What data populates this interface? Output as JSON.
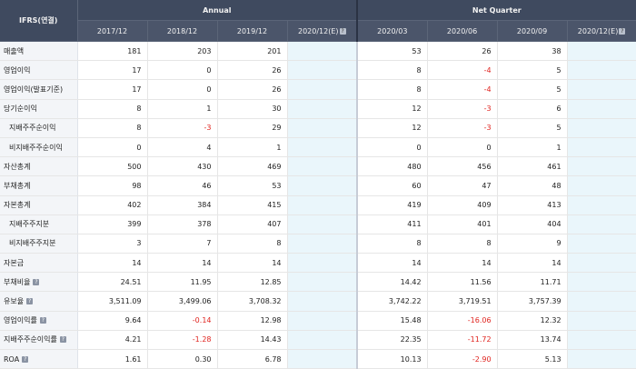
{
  "header": {
    "corner_label": "IFRS(연결)",
    "group_annual": "Annual",
    "group_quarter": "Net Quarter",
    "annual_cols": [
      "2017/12",
      "2018/12",
      "2019/12",
      "2020/12(E)"
    ],
    "quarter_cols": [
      "2020/03",
      "2020/06",
      "2020/09",
      "2020/12(E)"
    ],
    "estimate_help_icon": "?"
  },
  "rows": [
    {
      "label": "매출액",
      "indent": false,
      "help": false,
      "values": [
        "181",
        "203",
        "201",
        "",
        "53",
        "26",
        "38",
        ""
      ],
      "neg": [
        false,
        false,
        false,
        false,
        false,
        false,
        false,
        false
      ]
    },
    {
      "label": "영업이익",
      "indent": false,
      "help": false,
      "values": [
        "17",
        "0",
        "26",
        "",
        "8",
        "-4",
        "5",
        ""
      ],
      "neg": [
        false,
        false,
        false,
        false,
        false,
        true,
        false,
        false
      ]
    },
    {
      "label": "영업이익(발표기준)",
      "indent": false,
      "help": false,
      "values": [
        "17",
        "0",
        "26",
        "",
        "8",
        "-4",
        "5",
        ""
      ],
      "neg": [
        false,
        false,
        false,
        false,
        false,
        true,
        false,
        false
      ]
    },
    {
      "label": "당기순이익",
      "indent": false,
      "help": false,
      "values": [
        "8",
        "1",
        "30",
        "",
        "12",
        "-3",
        "6",
        ""
      ],
      "neg": [
        false,
        false,
        false,
        false,
        false,
        true,
        false,
        false
      ]
    },
    {
      "label": "지배주주순이익",
      "indent": true,
      "help": false,
      "values": [
        "8",
        "-3",
        "29",
        "",
        "12",
        "-3",
        "5",
        ""
      ],
      "neg": [
        false,
        true,
        false,
        false,
        false,
        true,
        false,
        false
      ]
    },
    {
      "label": "비지배주주순이익",
      "indent": true,
      "help": false,
      "values": [
        "0",
        "4",
        "1",
        "",
        "0",
        "0",
        "1",
        ""
      ],
      "neg": [
        false,
        false,
        false,
        false,
        false,
        false,
        false,
        false
      ]
    },
    {
      "label": "자산총계",
      "indent": false,
      "help": false,
      "values": [
        "500",
        "430",
        "469",
        "",
        "480",
        "456",
        "461",
        ""
      ],
      "neg": [
        false,
        false,
        false,
        false,
        false,
        false,
        false,
        false
      ]
    },
    {
      "label": "부채총계",
      "indent": false,
      "help": false,
      "values": [
        "98",
        "46",
        "53",
        "",
        "60",
        "47",
        "48",
        ""
      ],
      "neg": [
        false,
        false,
        false,
        false,
        false,
        false,
        false,
        false
      ]
    },
    {
      "label": "자본총계",
      "indent": false,
      "help": false,
      "values": [
        "402",
        "384",
        "415",
        "",
        "419",
        "409",
        "413",
        ""
      ],
      "neg": [
        false,
        false,
        false,
        false,
        false,
        false,
        false,
        false
      ]
    },
    {
      "label": "지배주주지분",
      "indent": true,
      "help": false,
      "values": [
        "399",
        "378",
        "407",
        "",
        "411",
        "401",
        "404",
        ""
      ],
      "neg": [
        false,
        false,
        false,
        false,
        false,
        false,
        false,
        false
      ]
    },
    {
      "label": "비지배주주지분",
      "indent": true,
      "help": false,
      "values": [
        "3",
        "7",
        "8",
        "",
        "8",
        "8",
        "9",
        ""
      ],
      "neg": [
        false,
        false,
        false,
        false,
        false,
        false,
        false,
        false
      ]
    },
    {
      "label": "자본금",
      "indent": false,
      "help": false,
      "values": [
        "14",
        "14",
        "14",
        "",
        "14",
        "14",
        "14",
        ""
      ],
      "neg": [
        false,
        false,
        false,
        false,
        false,
        false,
        false,
        false
      ]
    },
    {
      "label": "부채비율",
      "indent": false,
      "help": true,
      "values": [
        "24.51",
        "11.95",
        "12.85",
        "",
        "14.42",
        "11.56",
        "11.71",
        ""
      ],
      "neg": [
        false,
        false,
        false,
        false,
        false,
        false,
        false,
        false
      ]
    },
    {
      "label": "유보율",
      "indent": false,
      "help": true,
      "values": [
        "3,511.09",
        "3,499.06",
        "3,708.32",
        "",
        "3,742.22",
        "3,719.51",
        "3,757.39",
        ""
      ],
      "neg": [
        false,
        false,
        false,
        false,
        false,
        false,
        false,
        false
      ]
    },
    {
      "label": "영업이익률",
      "indent": false,
      "help": true,
      "values": [
        "9.64",
        "-0.14",
        "12.98",
        "",
        "15.48",
        "-16.06",
        "12.32",
        ""
      ],
      "neg": [
        false,
        true,
        false,
        false,
        false,
        true,
        false,
        false
      ]
    },
    {
      "label": "지배주주순이익률",
      "indent": false,
      "help": true,
      "values": [
        "4.21",
        "-1.28",
        "14.43",
        "",
        "22.35",
        "-11.72",
        "13.74",
        ""
      ],
      "neg": [
        false,
        true,
        false,
        false,
        false,
        true,
        false,
        false
      ]
    },
    {
      "label": "ROA",
      "indent": false,
      "help": true,
      "values": [
        "1.61",
        "0.30",
        "6.78",
        "",
        "10.13",
        "-2.90",
        "5.13",
        ""
      ],
      "neg": [
        false,
        false,
        false,
        false,
        false,
        true,
        false,
        false
      ]
    }
  ]
}
